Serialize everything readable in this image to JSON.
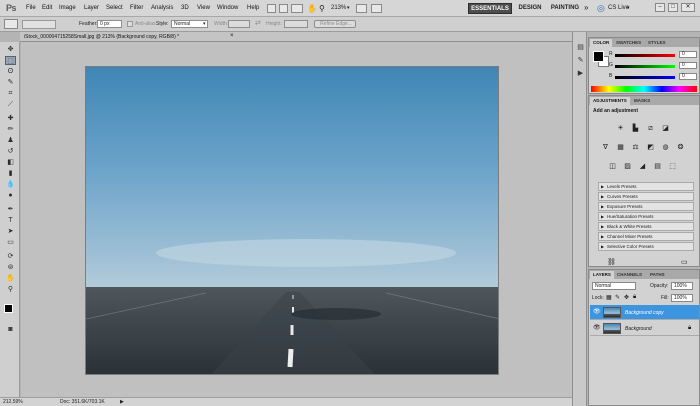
{
  "app": {
    "logo": "Ps"
  },
  "menubar": {
    "items": [
      "File",
      "Edit",
      "Image",
      "Layer",
      "Select",
      "Filter",
      "Analysis",
      "3D",
      "View",
      "Window",
      "Help"
    ],
    "zoom": "213%",
    "workspaces": [
      "ESSENTIALS",
      "DESIGN",
      "PAINTING"
    ],
    "more": "»",
    "cslive": "CS Live"
  },
  "options": {
    "feather_label": "Feather:",
    "feather_value": "0 px",
    "antialias_label": "Anti-alias",
    "style_label": "Style:",
    "style_value": "Normal",
    "width_label": "Width:",
    "height_label": "Height:",
    "refine_label": "Refine Edge..."
  },
  "document": {
    "tab_title": "iStock_000004715258Small.jpg @ 213% (Background copy, RGB/8) *",
    "close": "×"
  },
  "status": {
    "zoom": "212.59%",
    "doc": "Doc: 351.6K/703.1K"
  },
  "color_panel": {
    "tabs": [
      "COLOR",
      "SWATCHES",
      "STYLES"
    ],
    "channels": [
      {
        "label": "R",
        "value": "0",
        "color": "#e02020"
      },
      {
        "label": "G",
        "value": "0",
        "color": "#20b020"
      },
      {
        "label": "B",
        "value": "0",
        "color": "#2030e0"
      }
    ]
  },
  "adjustments_panel": {
    "tabs": [
      "ADJUSTMENTS",
      "MASKS"
    ],
    "title": "Add an adjustment",
    "presets": [
      "Levels Presets",
      "Curves Presets",
      "Exposure Presets",
      "Hue/Saturation Presets",
      "Black & White Presets",
      "Channel Mixer Presets",
      "Selective Color Presets"
    ]
  },
  "layers_panel": {
    "tabs": [
      "LAYERS",
      "CHANNELS",
      "PATHS"
    ],
    "blend_mode": "Normal",
    "opacity_label": "Opacity:",
    "opacity": "100%",
    "lock_label": "Lock:",
    "fill_label": "Fill:",
    "fill": "100%",
    "layers": [
      {
        "name": "Background copy",
        "selected": true
      },
      {
        "name": "Background",
        "selected": false
      }
    ]
  },
  "colors": {
    "accent": "#3d95e0",
    "selected_layer": "#3d95e0"
  }
}
